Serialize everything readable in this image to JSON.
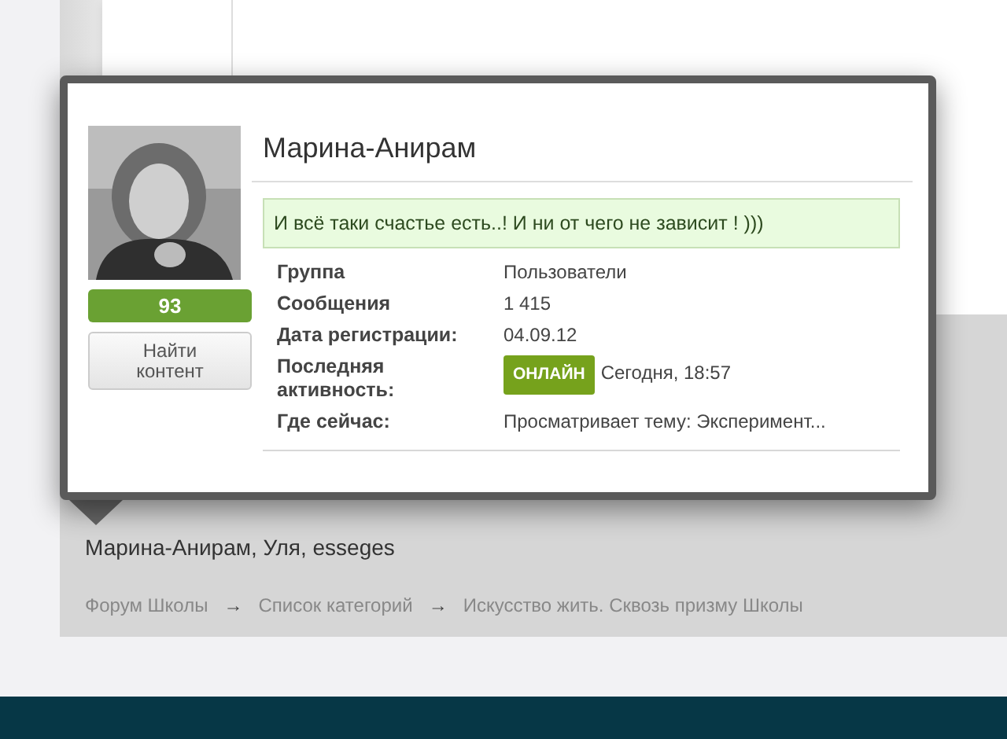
{
  "profile_card": {
    "name": "Марина-Анирам",
    "reputation": "93",
    "find_content_button": "Найти контент",
    "status_message": "И всё таки счастье есть..! И ни от чего не зависит ! )))",
    "fields": [
      {
        "kind": "text",
        "label": "Группа",
        "value": "Пользователи"
      },
      {
        "kind": "text",
        "label": "Сообщения",
        "value": "1 415"
      },
      {
        "kind": "text",
        "label": "Дата регистрации:",
        "value": "04.09.12"
      },
      {
        "kind": "activity",
        "label": "Последняя активность:",
        "badge": "ОНЛАЙН",
        "value": "Сегодня, 18:57"
      },
      {
        "kind": "text",
        "label": "Где сейчас:",
        "value": "Просматривает тему: Эксперимент..."
      }
    ]
  },
  "online_users": {
    "names": "Марина-Анирам, Уля, esseges"
  },
  "breadcrumbs": [
    "Форум Школы",
    "Список категорий",
    "Искусство жить. Сквозь призму Школы"
  ],
  "breadcrumb_separator": "→"
}
